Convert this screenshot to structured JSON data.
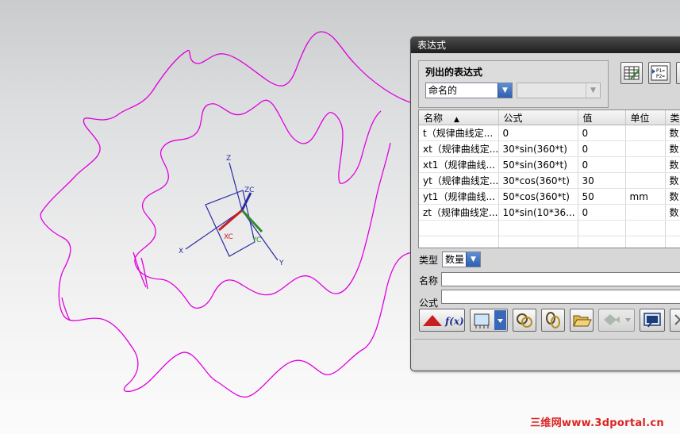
{
  "viewport": {
    "curve_color": "#e000e0",
    "axes": {
      "z_label": "Z",
      "x_label": "X",
      "y_label": "Y",
      "zc_label": "ZC",
      "xc_label": "XC",
      "yc_label": "YC"
    }
  },
  "dialog": {
    "title": "表达式",
    "listed_group": {
      "title": "列出的表达式",
      "filter_value": "命名的",
      "secondary_value": ""
    },
    "table": {
      "columns": [
        "名称",
        "公式",
        "值",
        "单位",
        "类"
      ],
      "rows": [
        {
          "name": "t（规律曲线定...",
          "formula": "0",
          "value": "0",
          "unit": "",
          "type": "数"
        },
        {
          "name": "xt（规律曲线定...",
          "formula": "30*sin(360*t)",
          "value": "0",
          "unit": "",
          "type": "数"
        },
        {
          "name": "xt1（规律曲线...",
          "formula": "50*sin(360*t)",
          "value": "0",
          "unit": "",
          "type": "数"
        },
        {
          "name": "yt（规律曲线定...",
          "formula": "30*cos(360*t)",
          "value": "30",
          "unit": "",
          "type": "数"
        },
        {
          "name": "yt1（规律曲线...",
          "formula": "50*cos(360*t)",
          "value": "50",
          "unit": "mm",
          "type": "数"
        },
        {
          "name": "zt（规律曲线定...",
          "formula": "10*sin(10*36...",
          "value": "0",
          "unit": "",
          "type": "数"
        }
      ]
    },
    "type_label": "类型",
    "type_value": "数量",
    "name_label": "名称",
    "name_value": "",
    "formula_label": "公式",
    "formula_value": "",
    "fx_label": "f(x)",
    "p_icon_text": "P1=\nP2="
  },
  "watermark": "三维网www.3dportal.cn"
}
